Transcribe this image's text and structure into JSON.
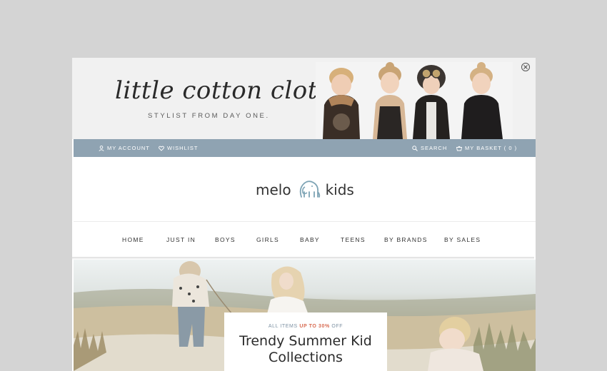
{
  "promo": {
    "logo": "little cotton clothes",
    "tagline": "STYLIST FROM DAY ONE."
  },
  "utility": {
    "account": "MY ACCOUNT",
    "wishlist": "WISHLIST",
    "search": "SEARCH",
    "basket": "MY BASKET ( 0 )"
  },
  "brand": {
    "left": "melo",
    "right": "kids"
  },
  "nav": {
    "items": [
      "HOME",
      "JUST IN",
      "BOYS",
      "GIRLS",
      "BABY",
      "TEENS",
      "BY BRANDS",
      "BY SALES"
    ]
  },
  "hero": {
    "eyebrow_pre": "ALL ITEMS ",
    "eyebrow_highlight": "UP TO 30%",
    "eyebrow_post": " OFF",
    "title_line1": "Trendy Summer Kid",
    "title_line2": "Collections"
  },
  "colors": {
    "page_bg": "#d4d4d4",
    "utility_bar": "#8fa3b2",
    "accent": "#d86b52"
  }
}
